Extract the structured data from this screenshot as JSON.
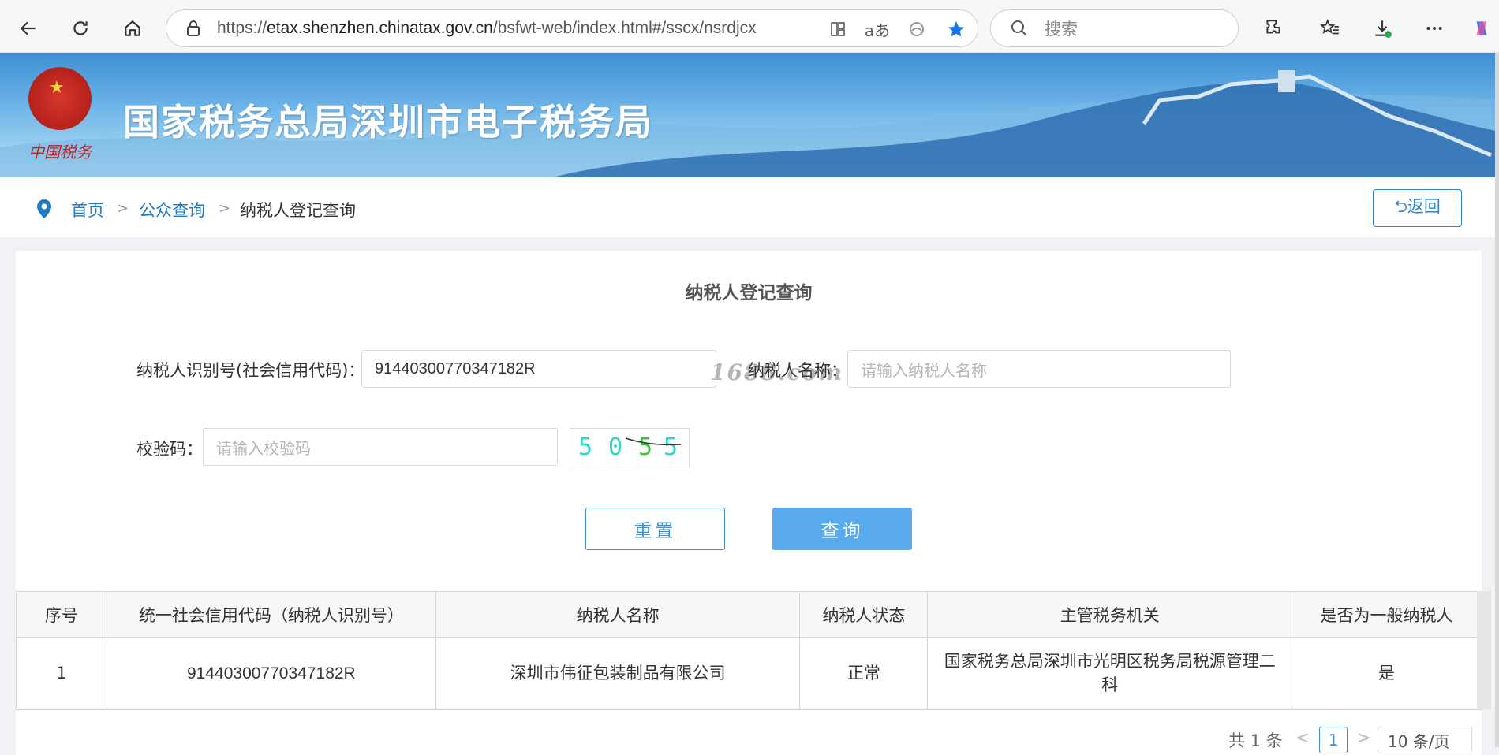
{
  "browser": {
    "url_prefix": "https://",
    "url_domain": "etax.shenzhen.chinatax.gov.cn",
    "url_path": "/bsfwt-web/index.html#/sscx/nsrdjcx",
    "reader_icon_text": "aあ",
    "search_placeholder": "搜索"
  },
  "banner": {
    "title": "国家税务总局深圳市电子税务局",
    "motto": "中国税务"
  },
  "breadcrumb": {
    "home": "首页",
    "separator": ">",
    "public_query": "公众查询",
    "current": "纳税人登记查询",
    "back_label": "⮌返回"
  },
  "form": {
    "title": "纳税人登记查询",
    "taxpayer_id_label": "纳税人识别号(社会信用代码)：",
    "taxpayer_id_value": "91440300770347182R",
    "taxpayer_name_label": "纳税人名称：",
    "taxpayer_name_placeholder": "请输入纳税人名称",
    "verify_label": "校验码：",
    "verify_placeholder": "请输入校验码",
    "captcha_chars": [
      "5",
      "0",
      "5",
      "5"
    ],
    "captcha_colors": [
      "#2fd6c8",
      "#2fd6c8",
      "#3ec43a",
      "#2fd6c8"
    ],
    "watermark": "1688.com",
    "reset_label": "重置",
    "query_label": "查询"
  },
  "table": {
    "headers": [
      "序号",
      "统一社会信用代码（纳税人识别号）",
      "纳税人名称",
      "纳税人状态",
      "主管税务机关",
      "是否为一般纳税人"
    ],
    "rows": [
      [
        "1",
        "91440300770347182R",
        "深圳市伟征包装制品有限公司",
        "正常",
        "国家税务总局深圳市光明区税务局税源管理二科",
        "是"
      ]
    ]
  },
  "pagination": {
    "total_text": "共 1 条",
    "prev": "<",
    "current_page": "1",
    "next": ">",
    "page_size": "10 条/页"
  },
  "colors": {
    "link_blue": "#1e7ac2",
    "query_button": "#5aabee"
  }
}
